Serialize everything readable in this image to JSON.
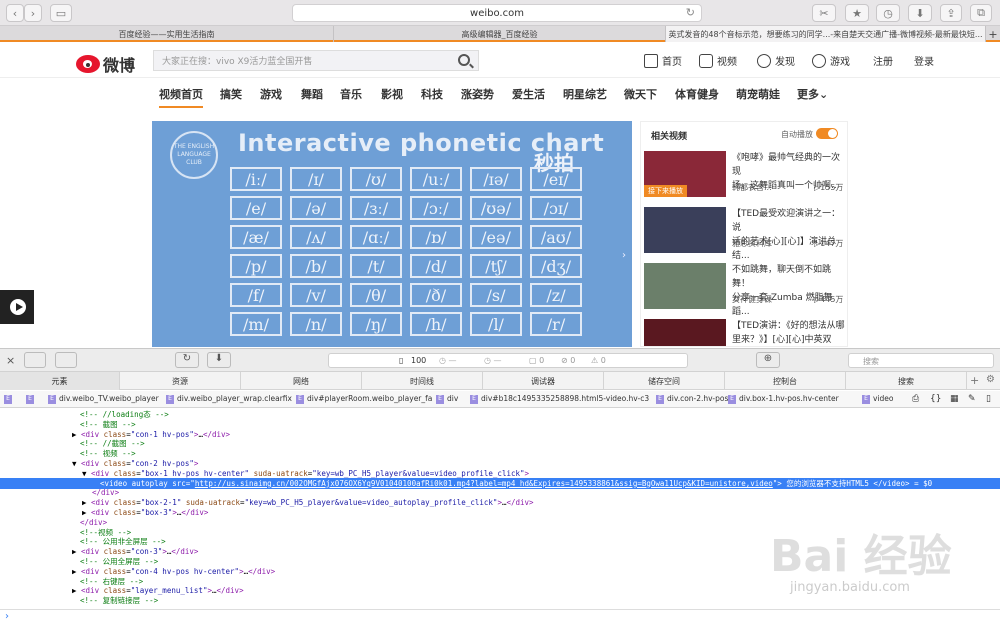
{
  "browser": {
    "url": "weibo.com",
    "tabs": [
      {
        "label": "百度经验——实用生活指南",
        "active": false
      },
      {
        "label": "高级编辑器_百度经验",
        "active": false
      },
      {
        "label": "英式发音的48个音标示范，想要练习的同学...-来自楚天交通广播-微博视频-最新最快短...",
        "active": true
      }
    ]
  },
  "header": {
    "logo_text": "微博",
    "search_placeholder": "大家正在搜：vivo X9活力蓝全国开售",
    "nav": [
      "首页",
      "视频",
      "发现",
      "游戏",
      "注册",
      "登录"
    ]
  },
  "categories": [
    "视频首页",
    "搞笑",
    "游戏",
    "舞蹈",
    "音乐",
    "影视",
    "科技",
    "涨姿势",
    "爱生活",
    "明星综艺",
    "微天下",
    "体育健身",
    "萌宠萌娃",
    "更多"
  ],
  "video": {
    "title": "Interactive phonetic chart",
    "club": "THE ENGLISH LANGUAGE CLUB",
    "watermark": "秒拍",
    "symbols": [
      "/iː/",
      "/ɪ/",
      "/ʊ/",
      "/uː/",
      "/ɪə/",
      "/eɪ/",
      "/e/",
      "/ə/",
      "/ɜː/",
      "/ɔː/",
      "/ʊə/",
      "/ɔɪ/",
      "/æ/",
      "/ʌ/",
      "/ɑː/",
      "/ɒ/",
      "/eə/",
      "/aʊ/",
      "/p/",
      "/b/",
      "/t/",
      "/d/",
      "/tʃ/",
      "/dʒ/",
      "/f/",
      "/v/",
      "/θ/",
      "/ð/",
      "/s/",
      "/z/",
      "/m/",
      "/n/",
      "/ŋ/",
      "/h/",
      "/l/",
      "/r/"
    ]
  },
  "related": {
    "title": "相关视频",
    "autoplay": "自动播放",
    "items": [
      {
        "line1": "《咆哮》最帅气经典的一次现",
        "line2": "场，这舞蹈真叫一个帅啊...",
        "author": "韩都衣舍...",
        "views": "▷155万",
        "badge": "接下来播放",
        "color": "#8a2838"
      },
      {
        "line1": "【TED最受欢迎演讲之一：说",
        "line2": "话的艺术[心][心]】演讲总结...",
        "author": "雅思资料库",
        "views": "▷147万",
        "badge": "",
        "color": "#3a3f5a"
      },
      {
        "line1": "不如跳舞，聊天倒不如跳舞！",
        "line2": "分享一套 Zumba 燃脂舞蹈...",
        "author": "女神健身课",
        "views": "▷445万",
        "badge": "",
        "color": "#6b7f6a"
      },
      {
        "line1": "【TED演讲：《好的想法从哪",
        "line2": "里来？》】[心][心]中英双字...",
        "author": "",
        "views": "",
        "badge": "",
        "color": "#5a1820"
      }
    ]
  },
  "devtools": {
    "counter": "100",
    "search_placeholder": "搜索",
    "tabs": [
      "元素",
      "资源",
      "网络",
      "时间线",
      "调试器",
      "储存空间",
      "控制台",
      "搜索"
    ],
    "breadcrumb": [
      "div.weibo_TV.weibo_player",
      "div.weibo_player_wrap.clearfix",
      "div#playerRoom.weibo_player_fa",
      "div",
      "div#b18c1495335258898.html5-video.hv-c3",
      "div.con-2.hv-pos",
      "div.box-1.hv-pos.hv-center",
      "video"
    ],
    "lines": [
      {
        "indent": 80,
        "html": "<span class='cm'>&lt;!-- //loading态 --&gt;</span>"
      },
      {
        "indent": 80,
        "html": "<span class='cm'>&lt;!-- 截图 --&gt;</span>"
      },
      {
        "indent": 72,
        "html": "▶ <span class='tg'>&lt;div</span> <span class='at'>class</span>=<span class='va'>\"con-1 hv-pos\"</span><span class='tg'>&gt;</span>…<span class='tg'>&lt;/div&gt;</span>"
      },
      {
        "indent": 80,
        "html": "<span class='cm'>&lt;!-- //截图 --&gt;</span>"
      },
      {
        "indent": 80,
        "html": "<span class='cm'>&lt;!-- 视频 --&gt;</span>"
      },
      {
        "indent": 72,
        "html": "▼ <span class='tg'>&lt;div</span> <span class='at'>class</span>=<span class='va'>\"con-2 hv-pos\"</span><span class='tg'>&gt;</span>"
      },
      {
        "indent": 82,
        "html": "▼ <span class='tg'>&lt;div</span> <span class='at'>class</span>=<span class='va'>\"box-1 hv-pos hv-center\"</span> <span class='at'>suda-uatrack</span>=<span class='va'>\"key=wb_PC_H5_player&amp;value=video_profile_click\"</span><span class='tg'>&gt;</span>"
      },
      {
        "indent": 100,
        "sel": true,
        "html": "&lt;video autoplay src=\"<u>http://us.sinaimg.cn/002OMGfAjx076OX6Yq9V01040100afRi0k01.mp4?label=mp4_hd&amp;Expires=1495338861&amp;ssig=BgOwa11Ucp&amp;KID=unistore,video</u>\"&gt; 您的浏览器不支持HTML5 &lt;/video&gt; = $0"
      },
      {
        "indent": 92,
        "html": "<span class='tg'>&lt;/div&gt;</span>"
      },
      {
        "indent": 82,
        "html": "▶ <span class='tg'>&lt;div</span> <span class='at'>class</span>=<span class='va'>\"box-2-1\"</span> <span class='at'>suda-uatrack</span>=<span class='va'>\"key=wb_PC_H5_player&amp;value=video_autoplay_profile_click\"</span><span class='tg'>&gt;</span>…<span class='tg'>&lt;/div&gt;</span>"
      },
      {
        "indent": 82,
        "html": "▶ <span class='tg'>&lt;div</span> <span class='at'>class</span>=<span class='va'>\"box-3\"</span><span class='tg'>&gt;</span>…<span class='tg'>&lt;/div&gt;</span>"
      },
      {
        "indent": 80,
        "html": "<span class='tg'>&lt;/div&gt;</span>"
      },
      {
        "indent": 80,
        "html": "<span class='cm'>&lt;!--视频 --&gt;</span>"
      },
      {
        "indent": 80,
        "html": "<span class='cm'>&lt;!-- 公用非全屏层 --&gt;</span>"
      },
      {
        "indent": 72,
        "html": "▶ <span class='tg'>&lt;div</span> <span class='at'>class</span>=<span class='va'>\"con-3\"</span><span class='tg'>&gt;</span>…<span class='tg'>&lt;/div&gt;</span>"
      },
      {
        "indent": 80,
        "html": "<span class='cm'>&lt;!-- 公用全屏层 --&gt;</span>"
      },
      {
        "indent": 72,
        "html": "▶ <span class='tg'>&lt;div</span> <span class='at'>class</span>=<span class='va'>\"con-4 hv-pos hv-center\"</span><span class='tg'>&gt;</span>…<span class='tg'>&lt;/div&gt;</span>"
      },
      {
        "indent": 80,
        "html": "<span class='cm'>&lt;!-- 右键层 --&gt;</span>"
      },
      {
        "indent": 72,
        "html": "▶ <span class='tg'>&lt;div</span> <span class='at'>class</span>=<span class='va'>\"layer_menu_list\"</span><span class='tg'>&gt;</span>…<span class='tg'>&lt;/div&gt;</span>"
      },
      {
        "indent": 80,
        "html": "<span class='cm'>&lt;!-- 复制链接层 --&gt;</span>"
      }
    ]
  },
  "watermark": {
    "text": "Bai 经验",
    "sub": "jingyan.baidu.com"
  }
}
